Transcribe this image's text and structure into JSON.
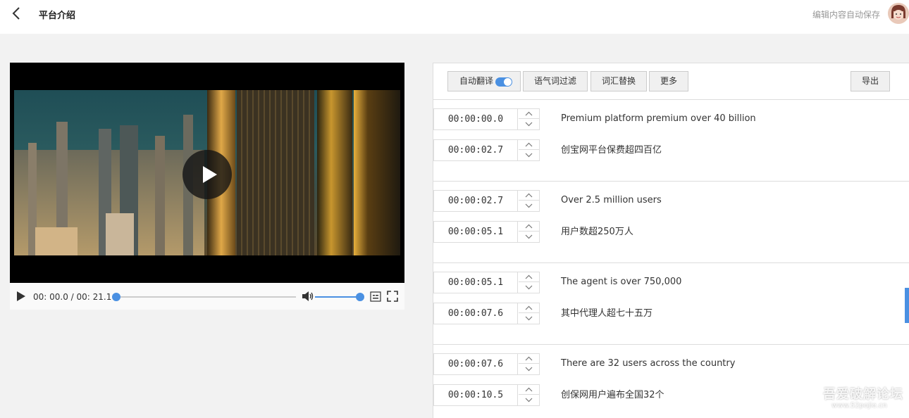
{
  "header": {
    "title": "平台介绍",
    "autosave": "编辑内容自动保存"
  },
  "player": {
    "time": "00: 00.0 / 00: 21.1",
    "progress": 0.0,
    "volume": 1.0
  },
  "toolbar": {
    "auto_translate": "自动翻译",
    "auto_translate_on": true,
    "filter_fillers": "语气词过滤",
    "replace_words": "词汇替换",
    "more": "更多",
    "export": "导出"
  },
  "segments": [
    {
      "start": "00:00:00.0",
      "end": "00:00:02.7",
      "source": "Premium platform premium over 40 billion",
      "translation": "创宝网平台保费超四百亿"
    },
    {
      "start": "00:00:02.7",
      "end": "00:00:05.1",
      "source": "Over 2.5 million users",
      "translation": "用户数超250万人"
    },
    {
      "start": "00:00:05.1",
      "end": "00:00:07.6",
      "source": "The agent is over 750,000",
      "translation": "其中代理人超七十五万"
    },
    {
      "start": "00:00:07.6",
      "end": "00:00:10.5",
      "source": "There are 32 users across the country",
      "translation": "创保网用户遍布全国32个"
    }
  ],
  "watermark": {
    "title": "吾爱破解论坛",
    "url": "www.52pojie.cn"
  },
  "colors": {
    "accent": "#4a90e2",
    "header_bg": "#ffffff",
    "page_bg": "#f2f2f2"
  }
}
